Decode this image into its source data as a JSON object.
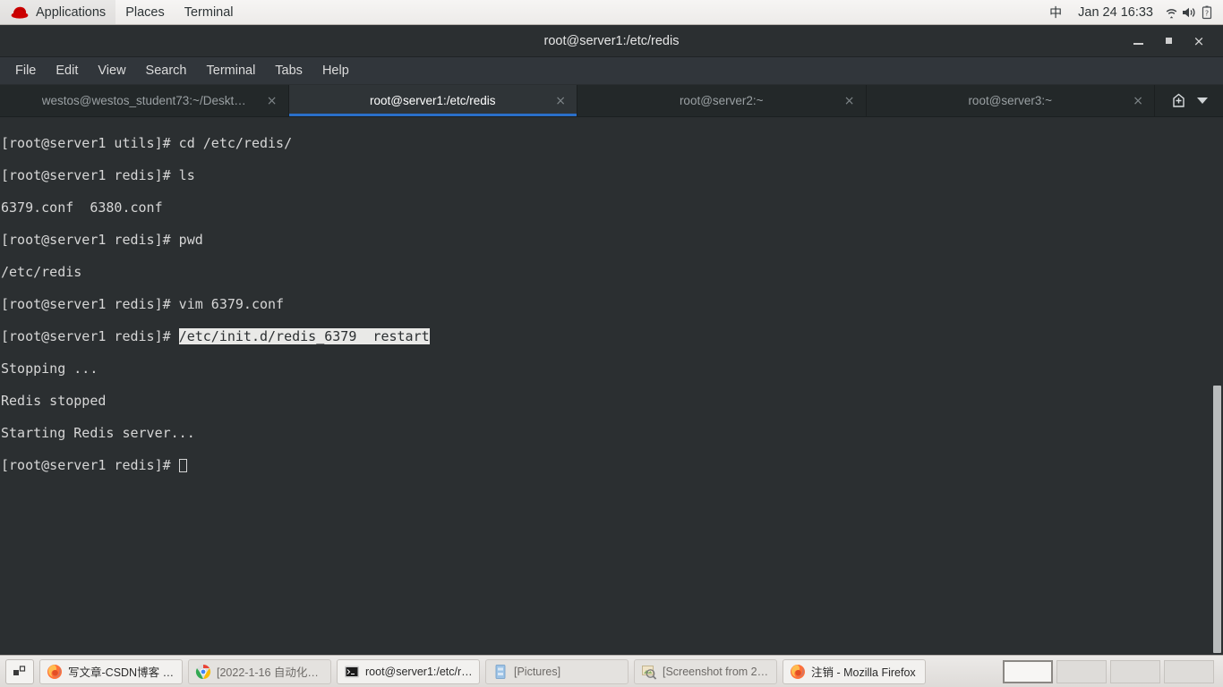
{
  "top_panel": {
    "logo": "redhat-logo",
    "menus": [
      {
        "label": "Applications"
      },
      {
        "label": "Places"
      },
      {
        "label": "Terminal"
      }
    ],
    "ime": "中",
    "clock": "Jan 24 16:33",
    "tray": [
      {
        "name": "wifi-icon"
      },
      {
        "name": "volume-icon"
      },
      {
        "name": "battery-icon"
      }
    ]
  },
  "window": {
    "title": "root@server1:/etc/redis",
    "controls": {
      "minimize": "minimize-button",
      "maximize": "maximize-button",
      "close": "×"
    },
    "menubar": [
      {
        "label": "File"
      },
      {
        "label": "Edit"
      },
      {
        "label": "View"
      },
      {
        "label": "Search"
      },
      {
        "label": "Terminal"
      },
      {
        "label": "Tabs"
      },
      {
        "label": "Help"
      }
    ],
    "tabs": [
      {
        "label": "westos@westos_student73:~/Deskt…",
        "active": false,
        "close": "×"
      },
      {
        "label": "root@server1:/etc/redis",
        "active": true,
        "close": "×"
      },
      {
        "label": "root@server2:~",
        "active": false,
        "close": "×"
      },
      {
        "label": "root@server3:~",
        "active": false,
        "close": "×"
      }
    ],
    "tab_actions": {
      "new_tab": "new-tab-icon",
      "tab_menu": "chevron-down-icon"
    }
  },
  "terminal": {
    "lines": [
      {
        "text": "[root@server1 utils]# cd /etc/redis/"
      },
      {
        "text": "[root@server1 redis]# ls"
      },
      {
        "text": "6379.conf  6380.conf"
      },
      {
        "text": "[root@server1 redis]# pwd"
      },
      {
        "text": "/etc/redis"
      },
      {
        "text": "[root@server1 redis]# vim 6379.conf"
      },
      {
        "prompt": "[root@server1 redis]# ",
        "selected": "/etc/init.d/redis_6379  restart"
      },
      {
        "text": "Stopping ..."
      },
      {
        "text": "Redis stopped"
      },
      {
        "text": "Starting Redis server..."
      },
      {
        "prompt": "[root@server1 redis]# ",
        "cursor": true
      }
    ],
    "colors": {
      "background": "#2b2f31",
      "foreground": "#d6d6d6",
      "selection_background": "#e9e9e7",
      "selection_foreground": "#2b2f31",
      "accent": "#2a6fc9"
    }
  },
  "taskbar": {
    "show_desktop": "show-desktop-icon",
    "tasks": [
      {
        "label": "写文章-CSDN博客 - …",
        "icon": "firefox-icon",
        "active": true
      },
      {
        "label": "[2022-1-16 自动化…",
        "icon": "chrome-icon",
        "active": false
      },
      {
        "label": "root@server1:/etc/r…",
        "icon": "terminal-icon",
        "active": true
      },
      {
        "label": "[Pictures]",
        "icon": "file-manager-icon",
        "active": false
      },
      {
        "label": "[Screenshot from 20…",
        "icon": "image-viewer-icon",
        "active": false
      },
      {
        "label": "注销 - Mozilla Firefox",
        "icon": "firefox-icon",
        "active": true
      }
    ],
    "workspaces": [
      {
        "name": "workspace-1",
        "active": true
      },
      {
        "name": "workspace-2",
        "active": false
      },
      {
        "name": "workspace-3",
        "active": false
      },
      {
        "name": "workspace-4",
        "active": false
      }
    ]
  }
}
